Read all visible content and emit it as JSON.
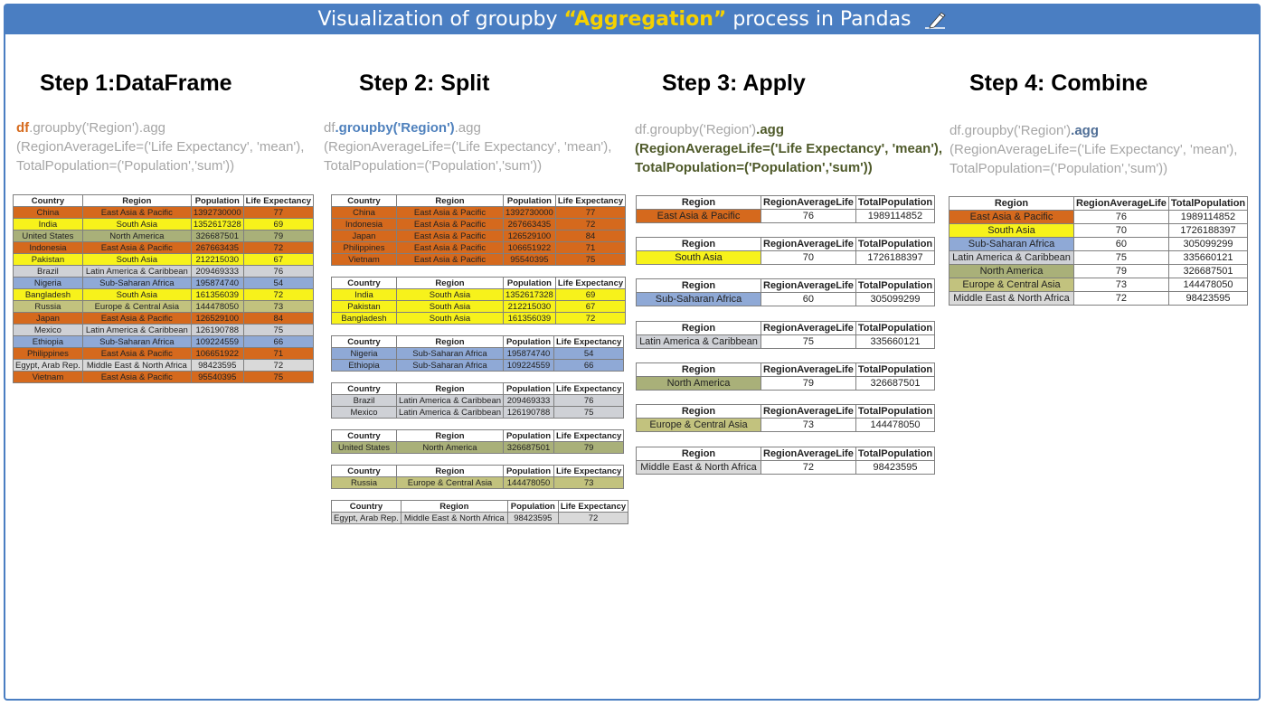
{
  "title": {
    "prefix": "Visualization of groupby ",
    "highlight": "“Aggregation”",
    "suffix": " process in Pandas"
  },
  "colors": {
    "East Asia & Pacific": "#d5691d",
    "South Asia": "#f7f21b",
    "North America": "#a9b079",
    "Sub-Saharan Africa": "#8fa9d6",
    "Latin America & Caribbean": "#cfd1d6",
    "Europe & Central Asia": "#c2c27e",
    "Middle East & North Africa": "#d9d9d9"
  },
  "steps": [
    {
      "title": "Step 1:DataFrame",
      "color": "#d66b1e"
    },
    {
      "title": "Step 2: Split",
      "color": "#8ea9cf"
    },
    {
      "title": "Step 3: Apply",
      "color": "#7f8b5a"
    },
    {
      "title": "Step 4: Combine",
      "color": "#4f81bd"
    }
  ],
  "code": {
    "line1_df": "df",
    "line1_groupby": ".groupby('Region')",
    "line1_agg": ".agg",
    "line2": "(RegionAverageLife=('Life Expectancy', 'mean'),",
    "line3": "TotalPopulation=('Population','sum'))"
  },
  "df_headers": [
    "Country",
    "Region",
    "Population",
    "Life Expectancy"
  ],
  "df_rows": [
    [
      "China",
      "East Asia & Pacific",
      "1392730000",
      "77"
    ],
    [
      "India",
      "South Asia",
      "1352617328",
      "69"
    ],
    [
      "United States",
      "North America",
      "326687501",
      "79"
    ],
    [
      "Indonesia",
      "East Asia & Pacific",
      "267663435",
      "72"
    ],
    [
      "Pakistan",
      "South Asia",
      "212215030",
      "67"
    ],
    [
      "Brazil",
      "Latin America & Caribbean",
      "209469333",
      "76"
    ],
    [
      "Nigeria",
      "Sub-Saharan Africa",
      "195874740",
      "54"
    ],
    [
      "Bangladesh",
      "South Asia",
      "161356039",
      "72"
    ],
    [
      "Russia",
      "Europe & Central Asia",
      "144478050",
      "73"
    ],
    [
      "Japan",
      "East Asia & Pacific",
      "126529100",
      "84"
    ],
    [
      "Mexico",
      "Latin America & Caribbean",
      "126190788",
      "75"
    ],
    [
      "Ethiopia",
      "Sub-Saharan Africa",
      "109224559",
      "66"
    ],
    [
      "Philippines",
      "East Asia & Pacific",
      "106651922",
      "71"
    ],
    [
      "Egypt, Arab Rep.",
      "Middle East & North Africa",
      "98423595",
      "72"
    ],
    [
      "Vietnam",
      "East Asia & Pacific",
      "95540395",
      "75"
    ]
  ],
  "split_groups": [
    {
      "rows": [
        [
          "China",
          "East Asia & Pacific",
          "1392730000",
          "77"
        ],
        [
          "Indonesia",
          "East Asia & Pacific",
          "267663435",
          "72"
        ],
        [
          "Japan",
          "East Asia & Pacific",
          "126529100",
          "84"
        ],
        [
          "Philippines",
          "East Asia & Pacific",
          "106651922",
          "71"
        ],
        [
          "Vietnam",
          "East Asia & Pacific",
          "95540395",
          "75"
        ]
      ]
    },
    {
      "rows": [
        [
          "India",
          "South Asia",
          "1352617328",
          "69"
        ],
        [
          "Pakistan",
          "South Asia",
          "212215030",
          "67"
        ],
        [
          "Bangladesh",
          "South Asia",
          "161356039",
          "72"
        ]
      ]
    },
    {
      "rows": [
        [
          "Nigeria",
          "Sub-Saharan Africa",
          "195874740",
          "54"
        ],
        [
          "Ethiopia",
          "Sub-Saharan Africa",
          "109224559",
          "66"
        ]
      ]
    },
    {
      "rows": [
        [
          "Brazil",
          "Latin America & Caribbean",
          "209469333",
          "76"
        ],
        [
          "Mexico",
          "Latin America & Caribbean",
          "126190788",
          "75"
        ]
      ]
    },
    {
      "rows": [
        [
          "United States",
          "North America",
          "326687501",
          "79"
        ]
      ]
    },
    {
      "rows": [
        [
          "Russia",
          "Europe & Central Asia",
          "144478050",
          "73"
        ]
      ]
    },
    {
      "rows": [
        [
          "Egypt, Arab Rep.",
          "Middle East & North Africa",
          "98423595",
          "72"
        ]
      ]
    }
  ],
  "agg_headers": [
    "Region",
    "RegionAverageLife",
    "TotalPopulation"
  ],
  "agg_rows": [
    [
      "East Asia & Pacific",
      "76",
      "1989114852"
    ],
    [
      "South Asia",
      "70",
      "1726188397"
    ],
    [
      "Sub-Saharan Africa",
      "60",
      "305099299"
    ],
    [
      "Latin America & Caribbean",
      "75",
      "335660121"
    ],
    [
      "North America",
      "79",
      "326687501"
    ],
    [
      "Europe & Central Asia",
      "73",
      "144478050"
    ],
    [
      "Middle East & North Africa",
      "72",
      "98423595"
    ]
  ]
}
